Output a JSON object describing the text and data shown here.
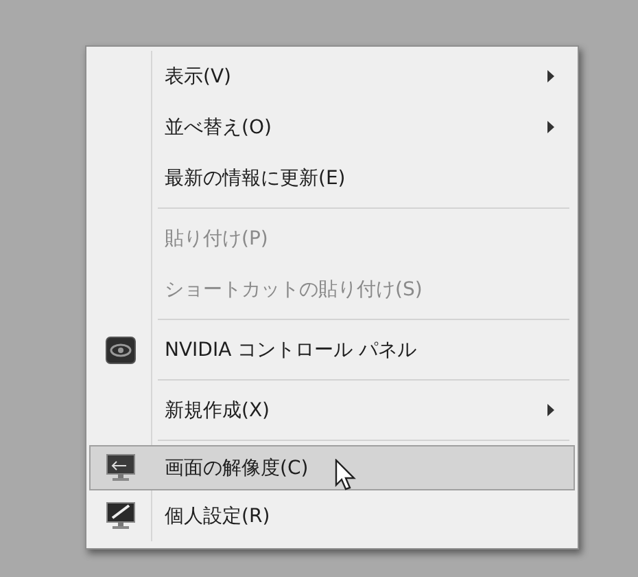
{
  "menu": {
    "items": [
      {
        "kind": "item",
        "label": "表示(V)",
        "disabled": false,
        "submenu": true,
        "selected": false
      },
      {
        "kind": "item",
        "label": "並べ替え(O)",
        "disabled": false,
        "submenu": true,
        "selected": false
      },
      {
        "kind": "item",
        "label": "最新の情報に更新(E)",
        "disabled": false,
        "submenu": false,
        "selected": false
      },
      {
        "kind": "separator"
      },
      {
        "kind": "item",
        "label": "貼り付け(P)",
        "disabled": true,
        "submenu": false,
        "selected": false
      },
      {
        "kind": "item",
        "label": "ショートカットの貼り付け(S)",
        "disabled": true,
        "submenu": false,
        "selected": false
      },
      {
        "kind": "separator"
      },
      {
        "kind": "item",
        "label": "NVIDIA コントロール パネル",
        "disabled": false,
        "submenu": false,
        "selected": false
      },
      {
        "kind": "separator"
      },
      {
        "kind": "item",
        "label": "新規作成(X)",
        "disabled": false,
        "submenu": true,
        "selected": false
      },
      {
        "kind": "separator"
      },
      {
        "kind": "item",
        "label": "画面の解像度(C)",
        "disabled": false,
        "submenu": false,
        "selected": true
      },
      {
        "kind": "item",
        "label": "個人設定(R)",
        "disabled": false,
        "submenu": false,
        "selected": false
      }
    ]
  }
}
